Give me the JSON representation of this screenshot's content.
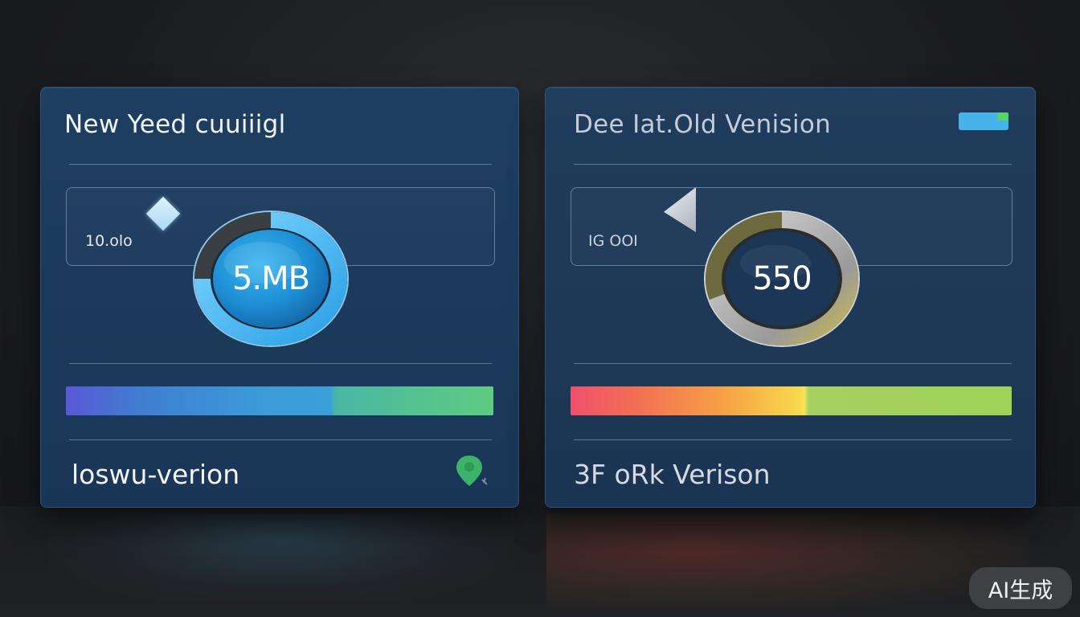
{
  "new_panel": {
    "title": "New Yeed cuuiiigl",
    "small_label": "10.olo",
    "gauge": {
      "value": "5.MB",
      "fill_fraction": 0.75
    },
    "footer": "loswu-verion"
  },
  "old_panel": {
    "title": "Dee Iat.Old Venision",
    "small_label": "IG OOI",
    "gauge": {
      "value": "550",
      "fill_fraction": 0.7
    },
    "footer": "3F oRk Verison"
  },
  "badge": {
    "label": "AI生成"
  },
  "colors": {
    "panel_bg": "#1c3a5c",
    "new_gauge": "#2fa6ea",
    "old_gauge": "#c9c9c9",
    "pin": "#3bb36a",
    "toggle": "#46b4ea"
  },
  "icons": {
    "new_panel_pin": "location-pin-icon",
    "old_panel_toggle": "toggle-switch-icon",
    "new_panel_diamond": "diamond-icon",
    "old_panel_shard": "triangle-shape-icon"
  }
}
